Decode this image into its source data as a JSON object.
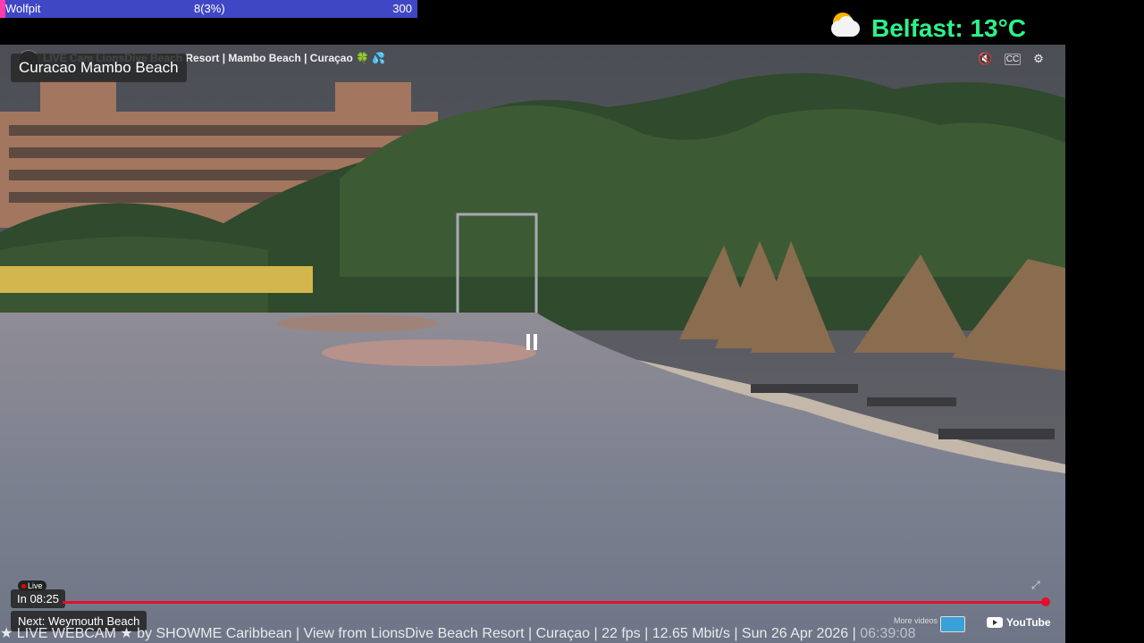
{
  "top_bar": {
    "name": "Wolfpit",
    "progress": "8(3%)",
    "max": "300",
    "color": "#3f47c4"
  },
  "weather": {
    "icon": "partly-cloudy-icon",
    "text": "Belfast: 13°C",
    "color": "#2df28b"
  },
  "video": {
    "title": "LIVE Cam LionsDive Beach Resort | Mambo Beach | Curaçao 🍀 💦",
    "location_label": "Curacao Mambo Beach",
    "live_badge": "Live",
    "countdown": "In 08:25",
    "next_label": "Next: Weymouth Beach",
    "more_videos": "More videos",
    "youtube": "YouTube",
    "controls": {
      "mute": "mute-icon",
      "captions": "captions-icon",
      "settings": "gear-icon"
    },
    "ticker_text": "★ LIVE WEBCAM ★ by SHOWME Caribbean | View from LionsDive Beach Resort | Curaçao | 22 fps | 12.65 Mbit/s | Sun 26 Apr 2026 | ",
    "ticker_time": "06:39:08",
    "progress_color": "#e0102c"
  }
}
